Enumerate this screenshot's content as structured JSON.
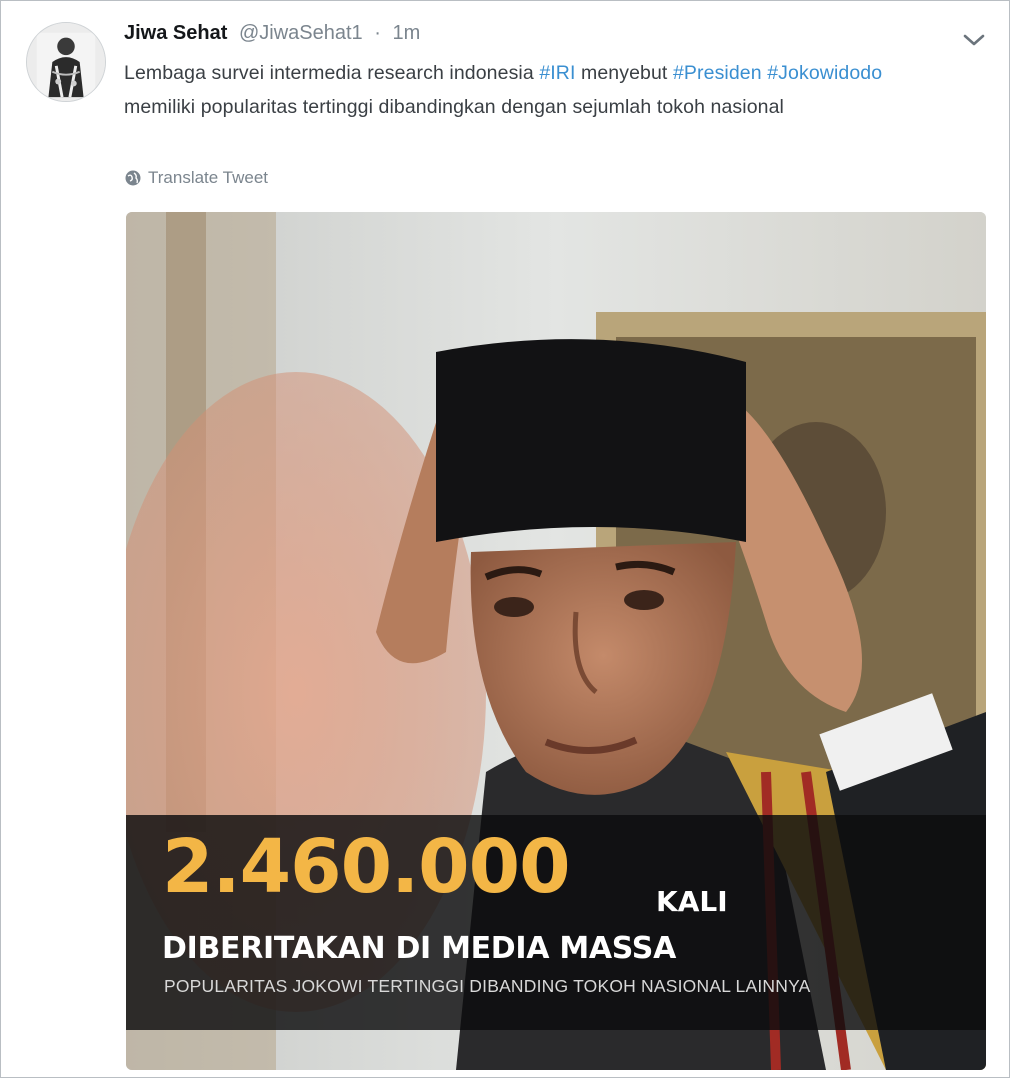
{
  "tweet": {
    "display_name": "Jiwa Sehat",
    "handle": "@JiwaSehat1",
    "separator": "·",
    "time": "1m",
    "text_parts": {
      "p1": "Lembaga survei intermedia research indonesia ",
      "tag1": "#IRI",
      "p2": " menyebut ",
      "tag2": "#Presiden",
      "p3": " ",
      "tag3": "#Jokowidodo",
      "p4": " memiliki popularitas tertinggi dibandingkan dengan sejumlah tokoh nasional"
    },
    "translate_label": "Translate Tweet"
  },
  "media": {
    "big_number": "2.460.000",
    "unit": "KALI",
    "headline": "DIBERITAKAN DI MEDIA MASSA",
    "subheadline": "POPULARITAS JOKOWI TERTINGGI DIBANDING TOKOH NASIONAL LAINNYA"
  },
  "icons": {
    "menu": "chevron-down-icon",
    "translate": "globe-icon"
  },
  "colors": {
    "hashtag": "#3a8fd1",
    "accent_number": "#f3b646",
    "muted": "#7b858e"
  }
}
